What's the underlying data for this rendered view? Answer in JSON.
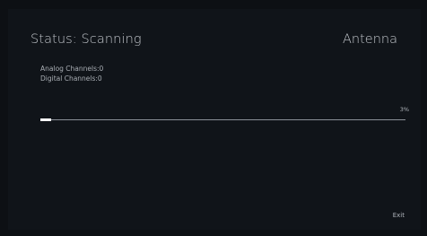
{
  "header": {
    "status": "Status: Scanning",
    "source": "Antenna"
  },
  "counts": {
    "analog": "Analog Channels:0",
    "digital": "Digital Channels:0"
  },
  "progress": {
    "label": "3%",
    "value": 0.03
  },
  "footer": {
    "exit_label": "Exit"
  },
  "colors": {
    "background": "#0d1014",
    "text": "#c3c7cc",
    "track": "#8a9097",
    "fill": "#ffffff"
  }
}
